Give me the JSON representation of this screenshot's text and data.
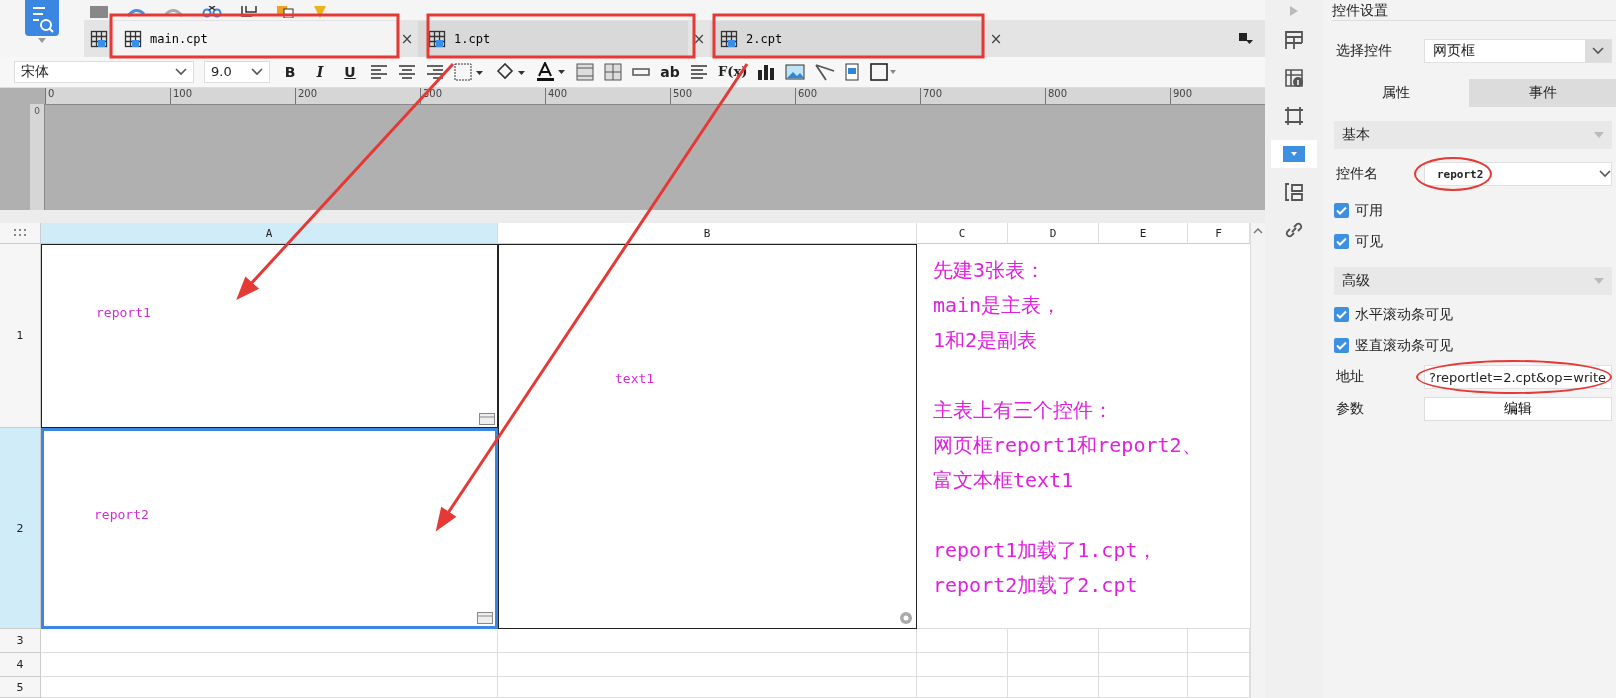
{
  "tabs": [
    {
      "label": "main.cpt",
      "selected": true,
      "close": "×"
    },
    {
      "label": "1.cpt",
      "selected": false,
      "close": "×"
    },
    {
      "label": "2.cpt",
      "selected": false,
      "close": "×"
    }
  ],
  "format_toolbar": {
    "font": "宋体",
    "size": "9.0",
    "bold": "B",
    "italic": "I",
    "underline": "U",
    "text_tool": "ab",
    "formula": "F(x)"
  },
  "ruler": {
    "labels": [
      "0",
      "100",
      "200",
      "300",
      "400",
      "500",
      "600",
      "700",
      "800",
      "900"
    ],
    "vertical_label": "0"
  },
  "sheet": {
    "columns": [
      {
        "label": "A",
        "selected": true
      },
      {
        "label": "B",
        "selected": false
      },
      {
        "label": "C",
        "selected": false
      },
      {
        "label": "D",
        "selected": false
      },
      {
        "label": "E",
        "selected": false
      },
      {
        "label": "F",
        "selected": false
      }
    ],
    "rows": [
      {
        "label": "1",
        "selected": false
      },
      {
        "label": "2",
        "selected": true
      },
      {
        "label": "3",
        "selected": false
      },
      {
        "label": "4",
        "selected": false
      },
      {
        "label": "5",
        "selected": false
      }
    ],
    "cells": [
      {
        "text": "report1",
        "selected": false
      },
      {
        "text": "text1",
        "selected": false
      },
      {
        "text": "report2",
        "selected": true
      }
    ]
  },
  "note": {
    "paragraphs": [
      [
        "先建3张表：",
        "main是主表，",
        "1和2是副表"
      ],
      [
        "主表上有三个控件：",
        "网页框report1和report2、",
        "富文本框text1"
      ],
      [
        "report1加载了1.cpt，",
        "report2加载了2.cpt"
      ]
    ]
  },
  "side_tools": [
    {
      "kind": "layout",
      "selected": false
    },
    {
      "kind": "cell-info",
      "selected": false
    },
    {
      "kind": "frame",
      "selected": false
    },
    {
      "kind": "widget",
      "selected": true
    },
    {
      "kind": "form",
      "selected": false
    },
    {
      "kind": "link",
      "selected": false
    }
  ],
  "panel": {
    "title": "控件设置",
    "widget_label": "选择控件",
    "widget_value": "网页框",
    "tabs": [
      {
        "label": "属性",
        "selected": true
      },
      {
        "label": "事件",
        "selected": false
      }
    ],
    "sections": [
      {
        "title": "基本",
        "items": [
          {
            "kind": "combo",
            "label": "控件名",
            "value": "report2"
          },
          {
            "kind": "checkbox",
            "label": "可用",
            "checked": true
          },
          {
            "kind": "checkbox",
            "label": "可见",
            "checked": true
          }
        ]
      },
      {
        "title": "高级",
        "items": [
          {
            "kind": "checkbox",
            "label": "水平滚动条可见",
            "checked": true
          },
          {
            "kind": "checkbox",
            "label": "竖直滚动条可见",
            "checked": true
          },
          {
            "kind": "text",
            "label": "地址",
            "value": "?reportlet=2.cpt&op=write"
          },
          {
            "kind": "button",
            "label": "参数",
            "value": "编辑"
          }
        ]
      }
    ]
  }
}
